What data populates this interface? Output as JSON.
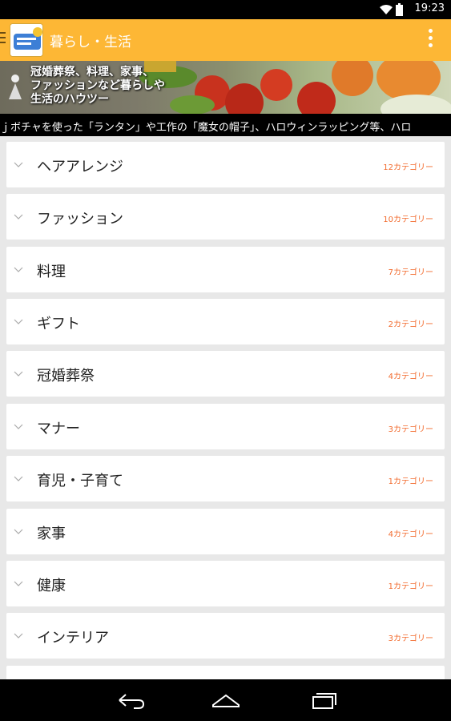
{
  "status_bar": {
    "time": "19:23"
  },
  "app_bar": {
    "title": "暮らし・生活"
  },
  "banner": {
    "lines": [
      "冠婚葬祭、料理、家事、",
      "ファッションなど暮らしや",
      "生活のハウツー"
    ]
  },
  "ticker": {
    "text": "ｊボチャを使った「ランタン」や工作の「魔女の帽子」、ハロウィンラッピング等、ハロ"
  },
  "categories": [
    {
      "label": "ヘアアレンジ",
      "count": "12カテゴリー"
    },
    {
      "label": "ファッション",
      "count": "10カテゴリー"
    },
    {
      "label": "料理",
      "count": "7カテゴリー"
    },
    {
      "label": "ギフト",
      "count": "2カテゴリー"
    },
    {
      "label": "冠婚葬祭",
      "count": "4カテゴリー"
    },
    {
      "label": "マナー",
      "count": "3カテゴリー"
    },
    {
      "label": "育児・子育て",
      "count": "1カテゴリー"
    },
    {
      "label": "家事",
      "count": "4カテゴリー"
    },
    {
      "label": "健康",
      "count": "1カテゴリー"
    },
    {
      "label": "インテリア",
      "count": "3カテゴリー"
    }
  ],
  "colors": {
    "accent": "#FDB735",
    "count_text": "#F26B2E"
  },
  "icons": [
    "wifi-icon",
    "battery-icon",
    "overflow-menu-icon",
    "chevron-down-icon",
    "back-icon",
    "home-icon",
    "recents-icon"
  ]
}
